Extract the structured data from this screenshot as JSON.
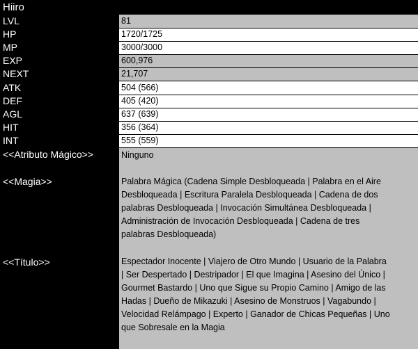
{
  "title": "Hiiro",
  "stats": [
    {
      "label": "LVL",
      "value": "81"
    },
    {
      "label": "HP",
      "value": "1720/1725"
    },
    {
      "label": "MP",
      "value": "3000/3000"
    },
    {
      "label": "EXP",
      "value": "600,976"
    },
    {
      "label": "NEXT",
      "value": "21,707"
    },
    {
      "label": "ATK",
      "value": "504 (566)"
    },
    {
      "label": "DEF",
      "value": "405 (420)"
    },
    {
      "label": "AGL",
      "value": "637 (639)"
    },
    {
      "label": "HIT",
      "value": "356 (364)"
    },
    {
      "label": "INT",
      "value": "555 (559)"
    }
  ],
  "atributo": {
    "label": "<<Atributo Mágico>>",
    "value": "Ninguno"
  },
  "magia": {
    "label": "<<Magia>>",
    "value": "Palabra Mágica (Cadena Simple Desbloqueada | Palabra en el Aire Desbloqueada | Escritura Paralela Desbloqueada | Cadena de dos palabras Desbloqueada | Invocación Simultánea Desbloqueada | Administración de Invocación Desbloqueada | Cadena de tres palabras Desbloqueada)"
  },
  "titulo": {
    "label": "<<Título>>",
    "value": "Espectador Inocente | Viajero de Otro Mundo | Usuario de la Palabra | Ser Despertado | Destripador | El que Imagina | Asesino del Único | Gourmet Bastardo | Uno que Sigue su Propio Camino | Amigo de las Hadas | Dueño de Mikazuki | Asesino de Monstruos | Vagabundo | Velocidad Relámpago | Experto | Ganador de Chicas Pequeñas | Uno que Sobresale en la Magia"
  }
}
